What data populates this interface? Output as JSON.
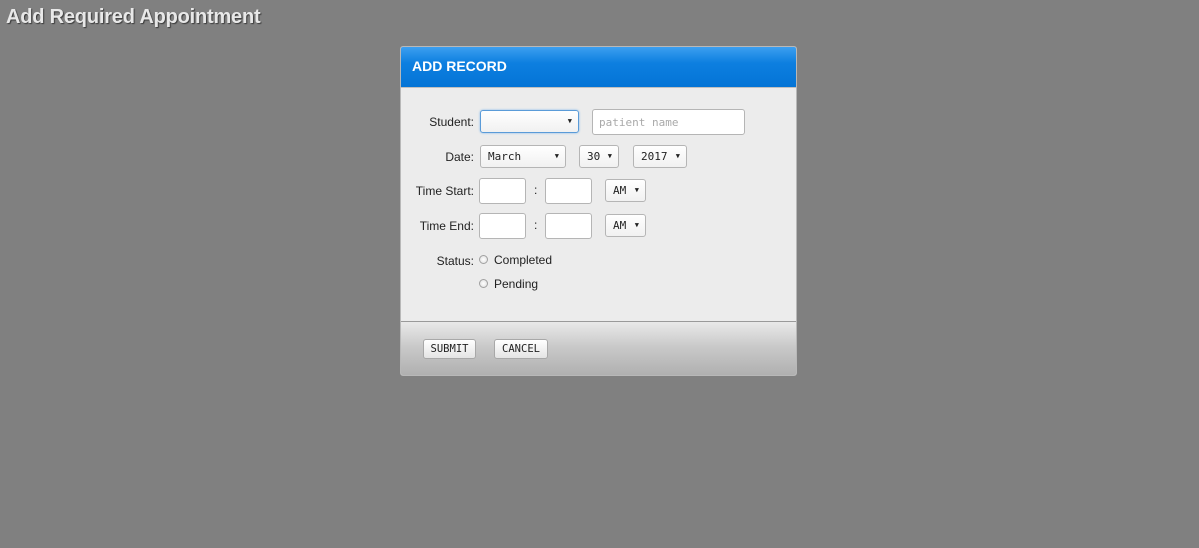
{
  "page": {
    "heading": "Add Required Appointment"
  },
  "dialog": {
    "title": "ADD RECORD",
    "header_color": "#0d7fe0",
    "student": {
      "label": "Student:",
      "selected": "",
      "name_placeholder": "patient name",
      "name_value": ""
    },
    "date": {
      "label": "Date:",
      "month": "March",
      "day": "30",
      "year": "2017"
    },
    "time_start": {
      "label": "Time Start:",
      "hour": "",
      "minute": "",
      "separator": ":",
      "meridiem": "AM"
    },
    "time_end": {
      "label": "Time End:",
      "hour": "",
      "minute": "",
      "separator": ":",
      "meridiem": "AM"
    },
    "status": {
      "label": "Status:",
      "options": [
        "Completed",
        "Pending"
      ],
      "selected": null
    },
    "buttons": {
      "submit": "SUBMIT",
      "cancel": "CANCEL"
    }
  },
  "icons": {
    "dropdown": "caret-down-icon",
    "radio": "radio-button-icon"
  }
}
